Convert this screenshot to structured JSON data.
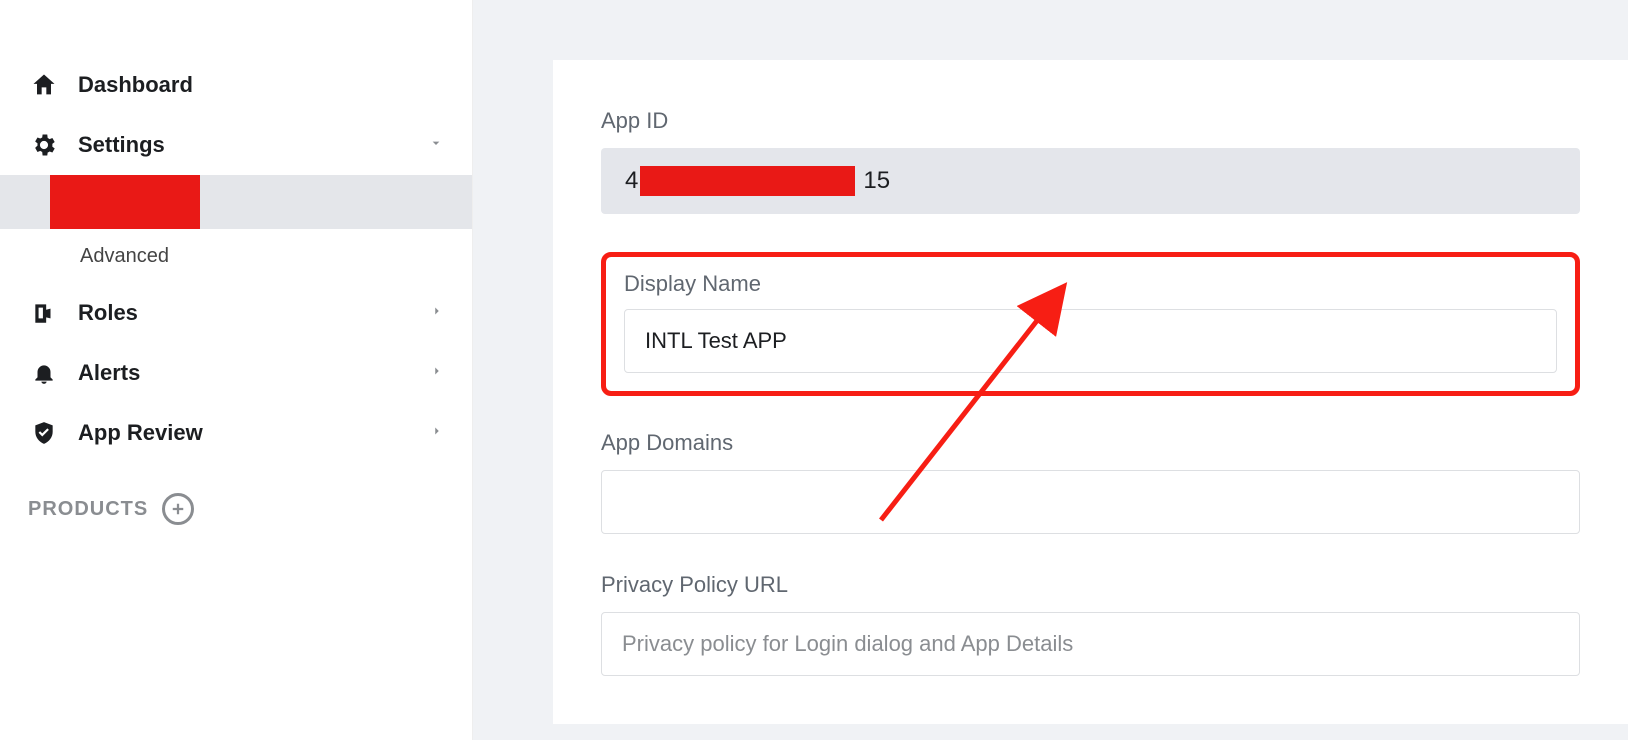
{
  "sidebar": {
    "items": [
      {
        "label": "Dashboard",
        "icon": "home-icon",
        "expandable": false
      },
      {
        "label": "Settings",
        "icon": "gear-icon",
        "expandable": true,
        "expanded": true,
        "children": [
          {
            "label": "",
            "active": true,
            "redacted": true
          },
          {
            "label": "Advanced",
            "active": false
          }
        ]
      },
      {
        "label": "Roles",
        "icon": "roles-icon",
        "expandable": true
      },
      {
        "label": "Alerts",
        "icon": "bell-icon",
        "expandable": true
      },
      {
        "label": "App Review",
        "icon": "shield-icon",
        "expandable": true
      }
    ],
    "products_header": "PRODUCTS"
  },
  "form": {
    "app_id": {
      "label": "App ID",
      "prefix": "4",
      "suffix": "15",
      "redacted": true
    },
    "display_name": {
      "label": "Display Name",
      "value": "INTL Test APP",
      "highlighted": true
    },
    "app_domains": {
      "label": "App Domains",
      "value": ""
    },
    "privacy_policy": {
      "label": "Privacy Policy URL",
      "value": "",
      "placeholder": "Privacy policy for Login dialog and App Details"
    }
  },
  "colors": {
    "redaction": "#e91916",
    "highlight_border": "#f71e14",
    "page_bg": "#f0f2f5",
    "readonly_bg": "#e4e6eb"
  }
}
